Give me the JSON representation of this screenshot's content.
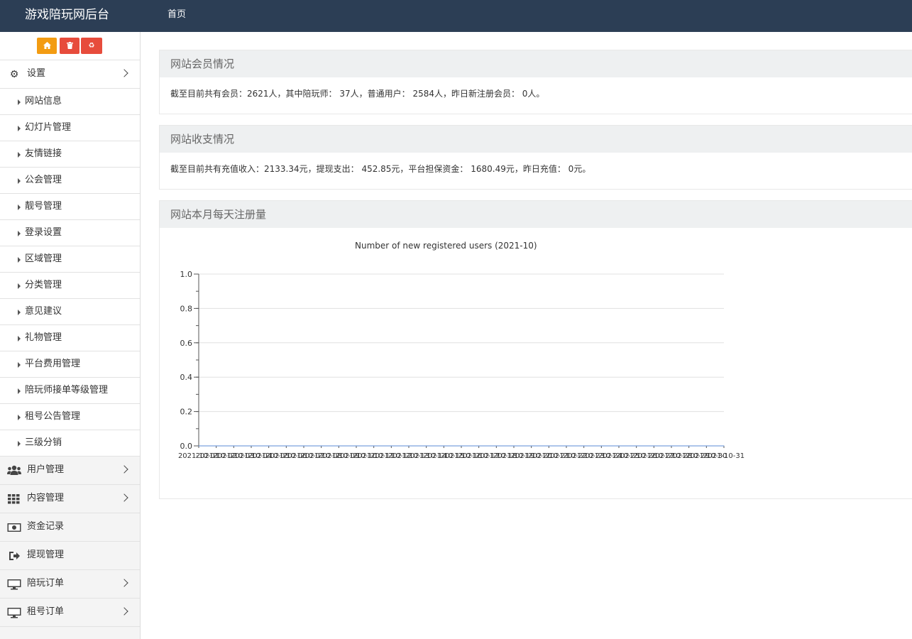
{
  "header": {
    "title": "游戏陪玩网后台",
    "nav_home": "首页"
  },
  "toolbar": {
    "home_icon": "home-icon",
    "delete_icon": "trash-icon",
    "recycle_icon": "recycle-icon"
  },
  "sidebar": {
    "settings": {
      "label": "设置",
      "icon": "gears-icon"
    },
    "settings_items": [
      "网站信息",
      "幻灯片管理",
      "友情链接",
      "公会管理",
      "靓号管理",
      "登录设置",
      "区域管理",
      "分类管理",
      "意见建议",
      "礼物管理",
      "平台费用管理",
      "陪玩师接单等级管理",
      "租号公告管理",
      "三级分销"
    ],
    "groups": [
      {
        "label": "用户管理",
        "icon": "users-icon",
        "has_chevron": true
      },
      {
        "label": "内容管理",
        "icon": "grid-icon",
        "has_chevron": true
      },
      {
        "label": "资金记录",
        "icon": "money-icon",
        "has_chevron": false
      },
      {
        "label": "提现管理",
        "icon": "sign-out-icon",
        "has_chevron": false
      },
      {
        "label": "陪玩订单",
        "icon": "monitor-icon",
        "has_chevron": true
      },
      {
        "label": "租号订单",
        "icon": "monitor-icon",
        "has_chevron": true
      }
    ]
  },
  "members": {
    "title": "网站会员情况",
    "text": "截至目前共有会员：2621人，其中陪玩师： 37人，普通用户： 2584人，昨日新注册会员： 0人。"
  },
  "finance": {
    "title": "网站收支情况",
    "text": "截至目前共有充值收入：2133.34元，提现支出： 452.85元，平台担保资金： 1680.49元，昨日充值： 0元。"
  },
  "registrations": {
    "title": "网站本月每天注册量"
  },
  "chart_data": {
    "type": "line",
    "title": "Number of new registered users (2021-10)",
    "x": [
      "2021-10-01",
      "2021-10-02",
      "2021-10-03",
      "2021-10-04",
      "2021-10-05",
      "2021-10-06",
      "2021-10-07",
      "2021-10-08",
      "2021-10-09",
      "2021-10-10",
      "2021-10-11",
      "2021-10-12",
      "2021-10-13",
      "2021-10-14",
      "2021-10-15",
      "2021-10-16",
      "2021-10-17",
      "2021-10-18",
      "2021-10-19",
      "2021-10-20",
      "2021-10-21",
      "2021-10-22",
      "2021-10-23",
      "2021-10-24",
      "2021-10-25",
      "2021-10-26",
      "2021-10-27",
      "2021-10-28",
      "2021-10-29",
      "2021-10-30",
      "2021-10-31"
    ],
    "values": [
      0,
      0,
      0,
      0,
      0,
      0,
      0,
      0,
      0,
      0,
      0,
      0,
      0,
      0,
      0,
      0,
      0,
      0,
      0,
      0,
      0,
      0,
      0,
      0,
      0,
      0,
      0,
      0,
      0,
      0,
      0
    ],
    "yticks": [
      "0.0",
      "0.2",
      "0.4",
      "0.6",
      "0.8",
      "1.0"
    ],
    "ylim": [
      0,
      1
    ],
    "grid": true,
    "xlabel": "",
    "ylabel": ""
  }
}
